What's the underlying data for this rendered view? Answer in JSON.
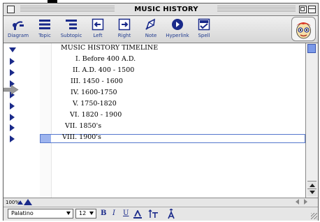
{
  "window": {
    "title": "MUSIC HISTORY TIMELINE"
  },
  "toolbar": {
    "items": [
      {
        "label": "Diagram",
        "icon": "diagram-icon"
      },
      {
        "label": "Topic",
        "icon": "topic-icon"
      },
      {
        "label": "Subtopic",
        "icon": "subtopic-icon"
      },
      {
        "label": "Left",
        "icon": "left-arrow-icon"
      },
      {
        "label": "Right",
        "icon": "right-arrow-icon"
      },
      {
        "label": "Note",
        "icon": "note-icon"
      },
      {
        "label": "Hyperlink",
        "icon": "hyperlink-icon"
      },
      {
        "label": "Spell",
        "icon": "spell-icon"
      }
    ]
  },
  "outline": {
    "main_topic": "MUSIC HISTORY TIMELINE",
    "subtopics": [
      "I.  Before 400 A.D.",
      "II.  A.D. 400 - 1500",
      "III.  1450 - 1600",
      "IV.  1600-1750",
      "V.  1750-1820",
      "VI.  1820 - 1900",
      "VII.  1850's",
      "VIII.  1900's"
    ],
    "selected_index": 7
  },
  "zoom": {
    "level": "100%"
  },
  "format": {
    "font": "Palatino",
    "size": "12",
    "bold": "B",
    "italic": "I",
    "underline": "U"
  },
  "colors": {
    "accent": "#1a2a8a",
    "selection": "#9db4ee",
    "link_label": "#1f3a8f"
  }
}
